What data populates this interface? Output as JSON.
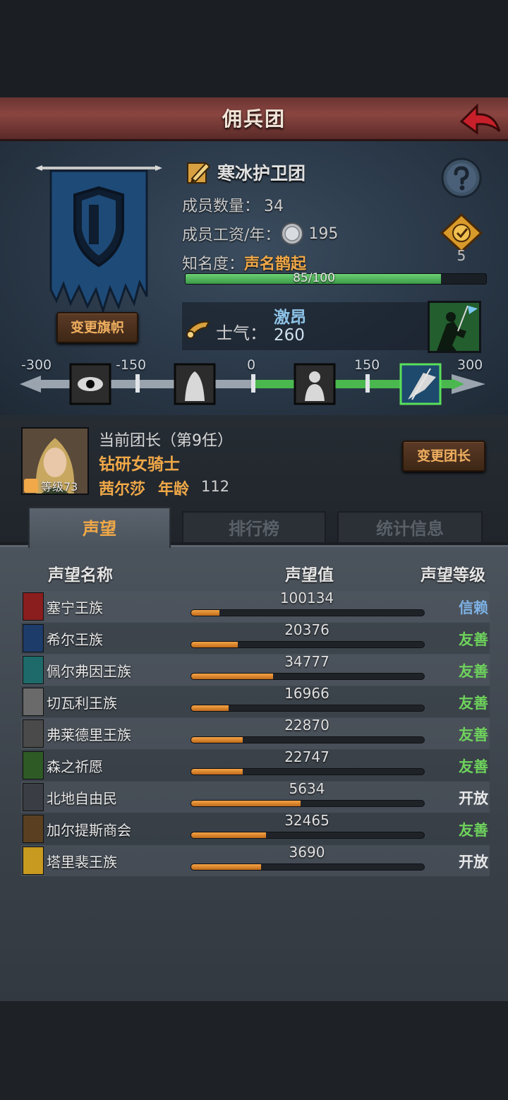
{
  "header": {
    "title": "佣兵团"
  },
  "guild": {
    "name": "寒冰护卫团",
    "members_label": "成员数量：",
    "members_value": "34",
    "wage_label": "成员工资/年：",
    "wage_value": "195",
    "fame_label": "知名度：",
    "fame_state": "声名鹊起",
    "fame_progress_text": "85/100",
    "fame_progress": 0.85,
    "rank_value": "5",
    "change_banner_label": "变更旗帜",
    "banner_color": "#1e4a78"
  },
  "morale": {
    "label": "士气：",
    "state": "激昂",
    "value": "260",
    "scale_labels": [
      "-300",
      "-150",
      "0",
      "150",
      "300"
    ]
  },
  "leader": {
    "title": "当前团长（第9任）",
    "class": "钻研女骑士",
    "name": "茜尔莎",
    "age_label": "年龄",
    "age_value": "112",
    "level_text": "等级73",
    "change_leader_label": "变更团长"
  },
  "tabs": [
    {
      "label": "声望",
      "active": true
    },
    {
      "label": "排行榜",
      "active": false
    },
    {
      "label": "统计信息",
      "active": false
    }
  ],
  "table": {
    "headers": {
      "name": "声望名称",
      "value": "声望值",
      "level": "声望等级"
    },
    "rows": [
      {
        "name": "塞宁王族",
        "value": "100134",
        "level": "信赖",
        "fill": 0.12,
        "crest_color": "#8a1e1e",
        "level_color": "#7eb2e6"
      },
      {
        "name": "希尔王族",
        "value": "20376",
        "level": "友善",
        "fill": 0.2,
        "crest_color": "#1e3c6a",
        "level_color": "#6ed35c"
      },
      {
        "name": "佩尔弗因王族",
        "value": "34777",
        "level": "友善",
        "fill": 0.35,
        "crest_color": "#1e6a6a",
        "level_color": "#6ed35c"
      },
      {
        "name": "切瓦利王族",
        "value": "16966",
        "level": "友善",
        "fill": 0.16,
        "crest_color": "#6a6a6a",
        "level_color": "#6ed35c"
      },
      {
        "name": "弗莱德里王族",
        "value": "22870",
        "level": "友善",
        "fill": 0.22,
        "crest_color": "#4a4a4a",
        "level_color": "#6ed35c"
      },
      {
        "name": "森之祈愿",
        "value": "22747",
        "level": "友善",
        "fill": 0.22,
        "crest_color": "#2e5a26",
        "level_color": "#6ed35c"
      },
      {
        "name": "北地自由民",
        "value": "5634",
        "level": "开放",
        "fill": 0.47,
        "crest_color": "#3a3e44",
        "level_color": "#e8e8e8"
      },
      {
        "name": "加尔提斯商会",
        "value": "32465",
        "level": "友善",
        "fill": 0.32,
        "crest_color": "#5a4020",
        "level_color": "#6ed35c"
      },
      {
        "name": "塔里裴王族",
        "value": "3690",
        "level": "开放",
        "fill": 0.3,
        "crest_color": "#c89a20",
        "level_color": "#e8e8e8"
      }
    ]
  }
}
